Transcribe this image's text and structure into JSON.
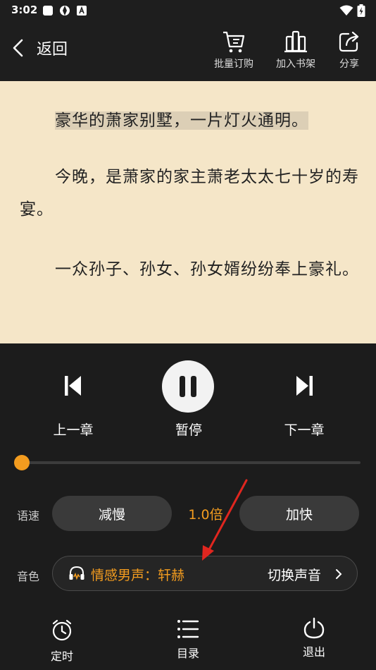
{
  "status_bar": {
    "time": "3:02"
  },
  "header": {
    "back_label": "返回",
    "actions": [
      {
        "label": "批量订购",
        "icon": "cart-list-icon"
      },
      {
        "label": "加入书架",
        "icon": "bookshelf-icon"
      },
      {
        "label": "分享",
        "icon": "share-icon"
      }
    ]
  },
  "reader": {
    "paragraphs": [
      "豪华的萧家别墅，一片灯火通明。",
      "今晚，是萧家的家主萧老太太七十岁的寿宴。",
      "一众孙子、孙女、孙女婿纷纷奉上豪礼。"
    ]
  },
  "player": {
    "prev_label": "上一章",
    "pause_label": "暂停",
    "next_label": "下一章",
    "progress": 0,
    "speed": {
      "row_label": "语速",
      "slower_label": "减慢",
      "value": "1.0倍",
      "faster_label": "加快"
    },
    "voice": {
      "row_label": "音色",
      "current": "情感男声：轩赫",
      "switch_label": "切换声音"
    },
    "bottom": [
      {
        "label": "定时",
        "icon": "alarm-clock-icon"
      },
      {
        "label": "目录",
        "icon": "menu-list-icon"
      },
      {
        "label": "退出",
        "icon": "power-icon"
      }
    ]
  },
  "colors": {
    "accent": "#f39c1f",
    "paper": "#f5e6c8",
    "dark": "#1c1c1c"
  }
}
